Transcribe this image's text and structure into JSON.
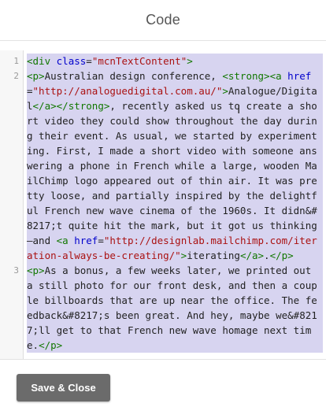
{
  "header": {
    "title": "Code"
  },
  "editor": {
    "lines": [
      {
        "num": "1",
        "tokens": [
          {
            "t": "tag",
            "v": "<div"
          },
          {
            "t": "txt",
            "v": " "
          },
          {
            "t": "attr",
            "v": "class"
          },
          {
            "t": "txt",
            "v": "="
          },
          {
            "t": "str",
            "v": "\"mcnTextContent\""
          },
          {
            "t": "tag",
            "v": ">"
          }
        ]
      },
      {
        "num": "2",
        "tokens": [
          {
            "t": "tag",
            "v": "<p>"
          },
          {
            "t": "txt",
            "v": "Australian design conference, "
          },
          {
            "t": "tag",
            "v": "<strong>"
          },
          {
            "t": "tag",
            "v": "<a"
          },
          {
            "t": "txt",
            "v": " "
          },
          {
            "t": "attr",
            "v": "href"
          },
          {
            "t": "txt",
            "v": "="
          },
          {
            "t": "str",
            "v": "\"http://analoguedigital.com.au/\""
          },
          {
            "t": "tag",
            "v": ">"
          },
          {
            "t": "txt",
            "v": "Analogue/Digital"
          },
          {
            "t": "tag",
            "v": "</a>"
          },
          {
            "t": "tag",
            "v": "</strong>"
          },
          {
            "t": "txt",
            "v": ", recently asked us to create a short video they could show throughout the day during their event. As usual, we started by experimenting. First, I made a short video with someone answering a phone in French while a large, wooden MailChimp logo appeared out of thin air. It was pretty loose, and partially inspired by the delightful French new wave cinema of the 1960s. It didn"
          },
          {
            "t": "ent",
            "v": "&#8217;"
          },
          {
            "t": "txt",
            "v": "t quite hit the mark, but it got us thinking—and "
          },
          {
            "t": "tag",
            "v": "<a"
          },
          {
            "t": "txt",
            "v": " "
          },
          {
            "t": "attr",
            "v": "href"
          },
          {
            "t": "txt",
            "v": "="
          },
          {
            "t": "str",
            "v": "\"http://designlab.mailchimp.com/iteration-always-be-creating/\""
          },
          {
            "t": "tag",
            "v": ">"
          },
          {
            "t": "txt",
            "v": "iterating"
          },
          {
            "t": "tag",
            "v": "</a>"
          },
          {
            "t": "txt",
            "v": "."
          },
          {
            "t": "tag",
            "v": "</p>"
          }
        ]
      },
      {
        "num": "3",
        "tokens": [
          {
            "t": "tag",
            "v": "<p>"
          },
          {
            "t": "txt",
            "v": "As a bonus, a few weeks later, we printed out a still photo for our front desk, and then a couple billboards that are up near the office. The feedback"
          },
          {
            "t": "ent",
            "v": "&#8217;"
          },
          {
            "t": "txt",
            "v": "s been great. And hey, maybe we"
          },
          {
            "t": "ent",
            "v": "&#8217;"
          },
          {
            "t": "txt",
            "v": "ll get to that French new wave homage next time."
          },
          {
            "t": "tag",
            "v": "</p>"
          }
        ]
      }
    ]
  },
  "footer": {
    "save_close_label": "Save & Close"
  },
  "colors": {
    "selection": "#d7d4f0",
    "tag": "#117700",
    "attr": "#0000cc",
    "string": "#aa1111",
    "button": "#6b6b6b"
  }
}
